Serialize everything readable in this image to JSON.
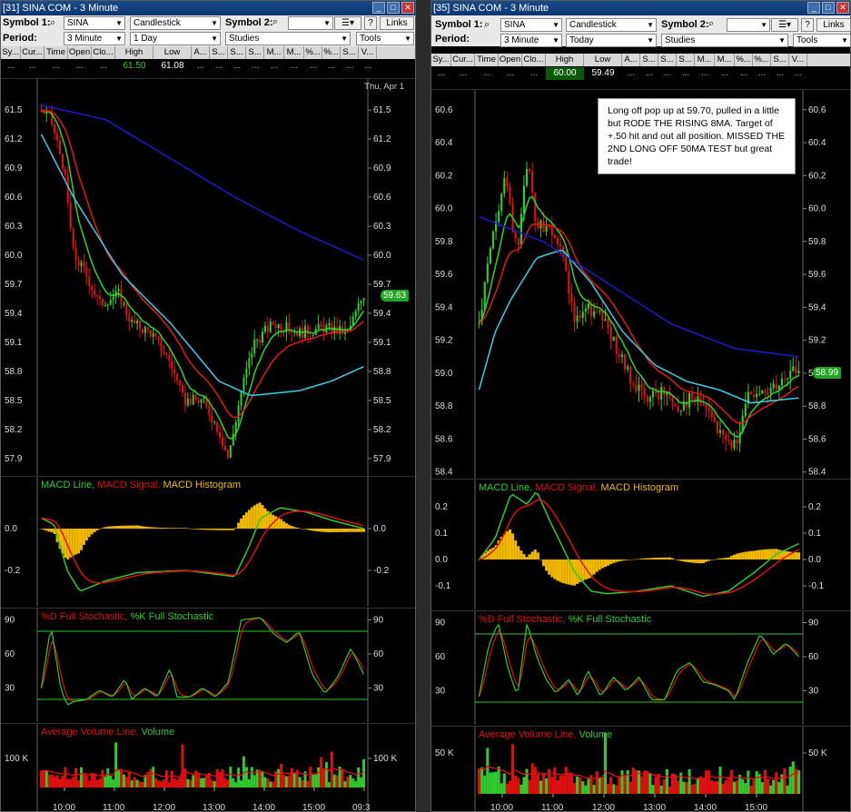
{
  "left": {
    "title": "[31] SINA COM - 3 Minute",
    "symbol1_label": "Symbol 1:",
    "symbol1_value": "SINA",
    "chart_style": "Candlestick",
    "symbol2_label": "Symbol 2:",
    "period_label": "Period:",
    "interval": "3 Minute",
    "range": "1 Day",
    "studies": "Studies",
    "tools": "Tools",
    "links": "Links",
    "help": "?",
    "quote_headers": [
      "Sy...",
      "Cur...",
      "Time",
      "Open",
      "Clo...",
      "High",
      "Low",
      "A...",
      "S...",
      "S...",
      "S...",
      "M...",
      "M...",
      "%...",
      "%...",
      "S...",
      "V..."
    ],
    "quote_values": [
      "...",
      "...",
      "...",
      "...",
      "...",
      "61.50",
      "61.08",
      "...",
      "...",
      "...",
      "...",
      "...",
      "...",
      "...",
      "...",
      "...",
      "..."
    ],
    "date_label": "Thu, Apr 1",
    "price_ticks": [
      "61.5",
      "61.2",
      "60.9",
      "60.6",
      "60.3",
      "60.0",
      "59.7",
      "59.4",
      "59.1",
      "58.8",
      "58.5",
      "58.2",
      "57.9"
    ],
    "price_tag": "59.63",
    "macd_legend": {
      "line": "MACD Line,",
      "signal": "MACD Signal,",
      "hist": "MACD Histogram"
    },
    "macd_ticks": [
      "0.0",
      "-0.2"
    ],
    "stoch_legend": {
      "d": "%D Full Stochastic,",
      "k": "%K Full Stochastic"
    },
    "stoch_ticks": [
      "90",
      "60",
      "30"
    ],
    "vol_legend": {
      "avg": "Average Volume Line,",
      "vol": "Volume"
    },
    "vol_ticks": [
      "100 K"
    ],
    "time_ticks": [
      "10:00",
      "11:00",
      "12:00",
      "13:00",
      "14:00",
      "15:00",
      "09:3"
    ]
  },
  "right": {
    "title": "[35] SINA COM - 3 Minute",
    "symbol1_label": "Symbol 1:",
    "symbol1_value": "SINA",
    "chart_style": "Candlestick",
    "symbol2_label": "Symbol 2:",
    "period_label": "Period:",
    "interval": "3 Minute",
    "range": "Today",
    "studies": "Studies",
    "tools": "Tools",
    "links": "Links",
    "help": "?",
    "quote_headers": [
      "Sy...",
      "Cur...",
      "Time",
      "Open",
      "Clo...",
      "High",
      "Low",
      "A...",
      "S...",
      "S...",
      "S...",
      "M...",
      "M...",
      "%...",
      "%...",
      "S...",
      "V..."
    ],
    "quote_values": [
      "...",
      "...",
      "...",
      "...",
      "...",
      "60.00",
      "59.49",
      "...",
      "...",
      "...",
      "...",
      "...",
      "...",
      "...",
      "...",
      "...",
      "..."
    ],
    "price_ticks": [
      "60.6",
      "60.4",
      "60.2",
      "60.0",
      "59.8",
      "59.6",
      "59.4",
      "59.2",
      "59.0",
      "58.8",
      "58.6",
      "58.4"
    ],
    "price_tag": "58.99",
    "annotation": "Long off pop up at 59.70, pulled in a little but RODE THE RISING 8MA. Target of +.50 hit and out all position.  MISSED THE 2ND LONG OFF 50MA TEST but great trade!",
    "macd_legend": {
      "line": "MACD Line,",
      "signal": "MACD Signal,",
      "hist": "MACD Histogram"
    },
    "macd_ticks": [
      "0.2",
      "0.1",
      "0.0",
      "-0.1"
    ],
    "stoch_legend": {
      "d": "%D Full Stochastic,",
      "k": "%K Full Stochastic"
    },
    "stoch_ticks": [
      "90",
      "60",
      "30"
    ],
    "vol_legend": {
      "avg": "Average Volume Line,",
      "vol": "Volume"
    },
    "vol_ticks": [
      "50 K"
    ],
    "time_ticks": [
      "10:00",
      "11:00",
      "12:00",
      "13:00",
      "14:00",
      "15:00"
    ]
  },
  "colors": {
    "up": "#2ecc2e",
    "down": "#e01010",
    "ma8": "#27d827",
    "ma20": "#e81818",
    "ma50": "#38d0e8",
    "ma200": "#1a1ad0",
    "hist": "#f0b800",
    "title_bg": "#0d3570"
  }
}
